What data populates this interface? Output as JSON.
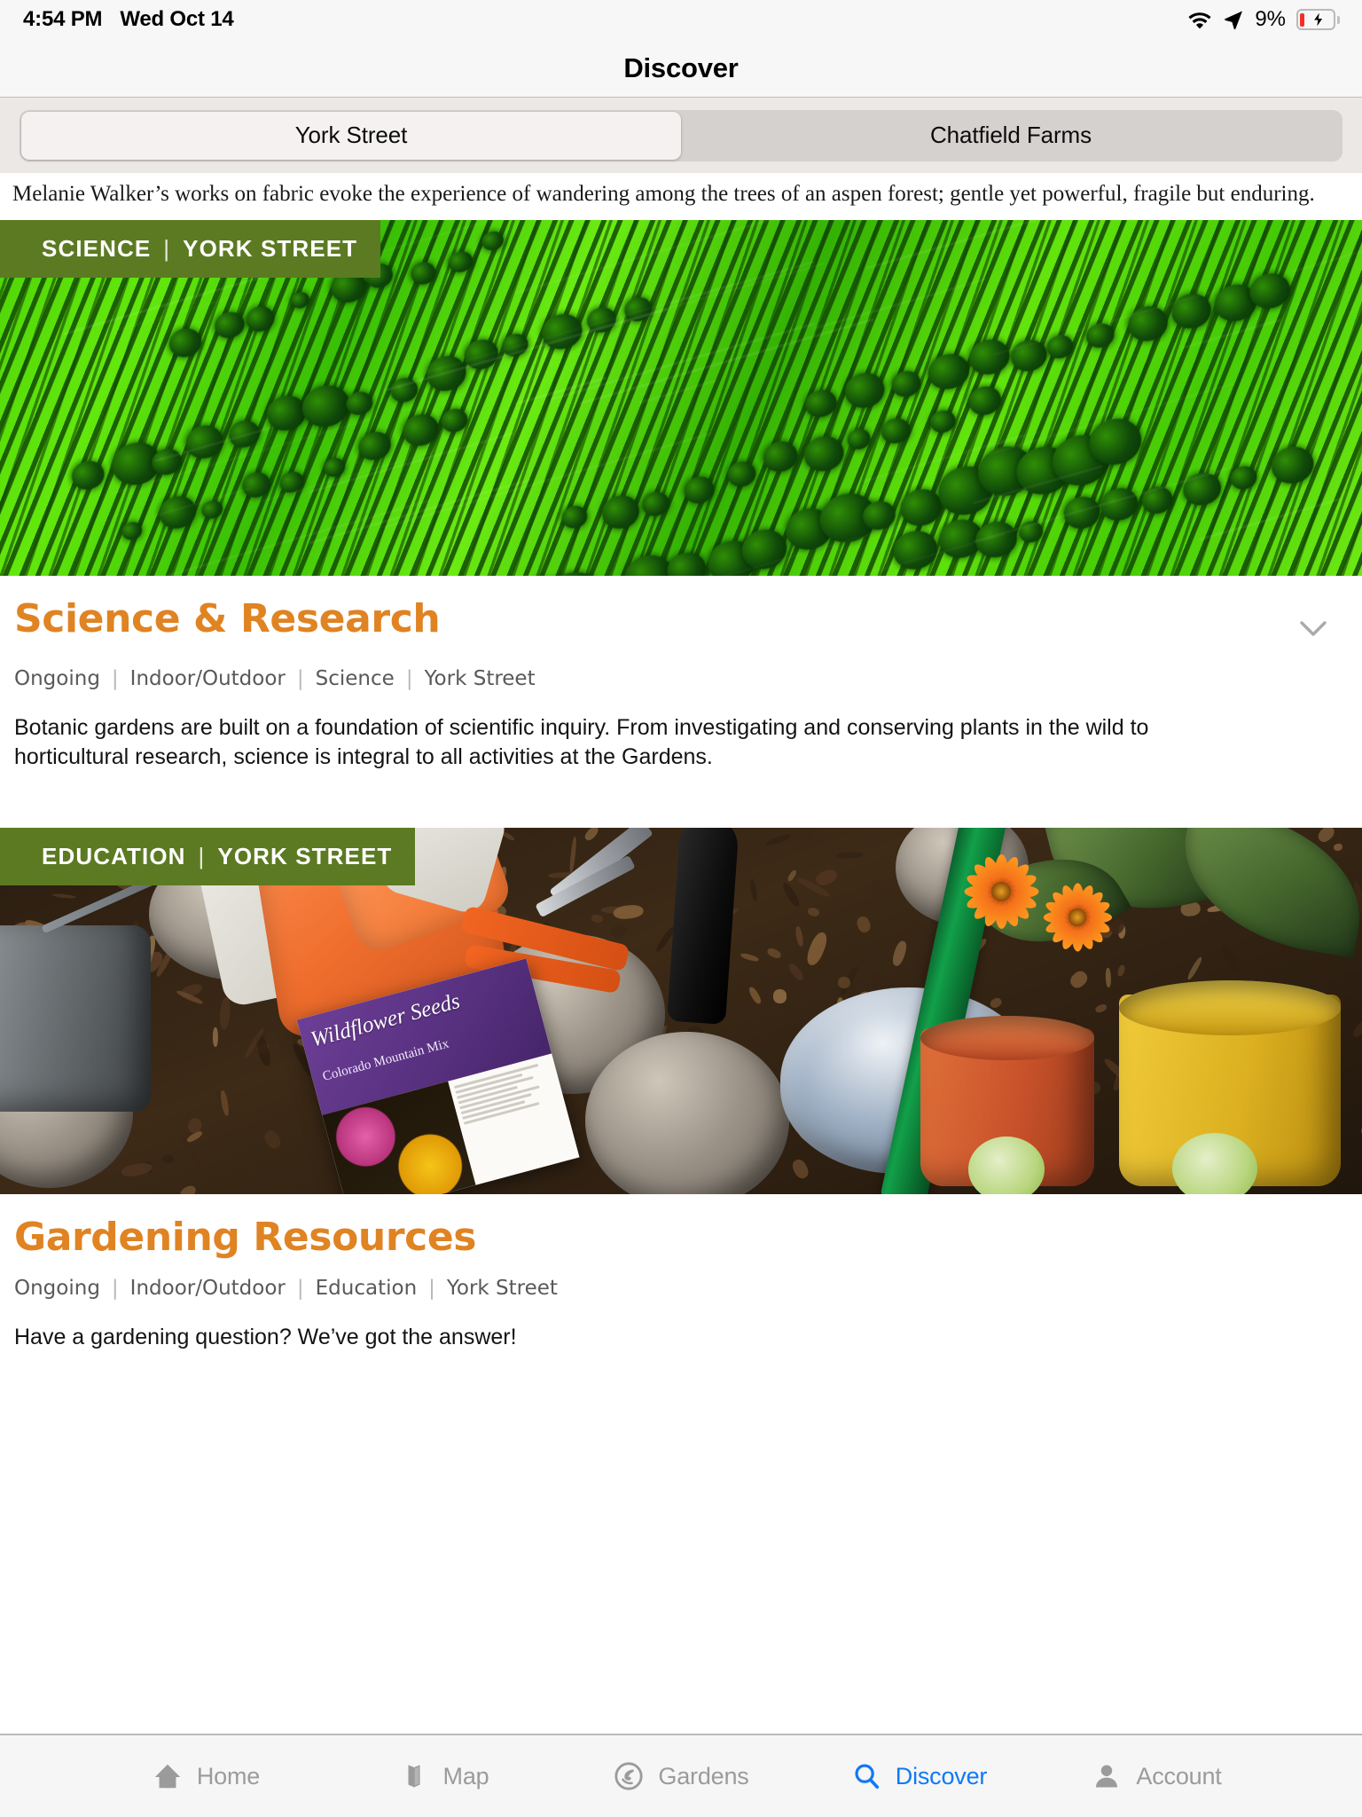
{
  "status_bar": {
    "time": "4:54 PM",
    "date": "Wed Oct 14",
    "wifi_icon": "wifi-icon",
    "location_icon": "location-arrow-icon",
    "battery_percent": "9%",
    "battery_icon": "battery-charging-icon",
    "battery_level": 9,
    "battery_color": "#f03027"
  },
  "navbar": {
    "title": "Discover"
  },
  "segmented_control": {
    "selected_index": 0,
    "options": [
      {
        "label": "York Street",
        "selected": true
      },
      {
        "label": "Chatfield Farms",
        "selected": false
      }
    ]
  },
  "lead_text": "Melanie Walker’s works on fabric evoke the experience of wandering among the trees of an aspen forest; gentle yet powerful, fragile but enduring.",
  "colors": {
    "accent_orange": "#e08322",
    "banner_green": "#5c7a22",
    "active_tab_blue": "#1079f5",
    "meta_gray": "#58595b"
  },
  "cards": [
    {
      "banner_category": "SCIENCE",
      "banner_divider": "|",
      "banner_location": "YORK STREET",
      "image_alt": "green plant cell microscopy",
      "title": "Science & Research",
      "meta": [
        "Ongoing",
        "Indoor/Outdoor",
        "Science",
        "York Street"
      ],
      "description": "Botanic gardens are built on a foundation of scientific inquiry. From investigating and conserving plants in the wild to horticultural research, science is integral to all activities at the Gardens.",
      "chevron_icon": "chevron-down-icon",
      "has_chevron": true
    },
    {
      "banner_category": "EDUCATION",
      "banner_divider": "|",
      "banner_location": "YORK STREET",
      "image_alt": "gardening tools, gloves, pots and wildflower seed packet",
      "title": "Gardening Resources",
      "meta": [
        "Ongoing",
        "Indoor/Outdoor",
        "Education",
        "York Street"
      ],
      "description": "Have a gardening question? We’ve got the answer!",
      "chevron_icon": "chevron-down-icon",
      "has_chevron": false
    }
  ],
  "seed_packet": {
    "title": "Wildflower Seeds",
    "subtitle": "Colorado Mountain Mix"
  },
  "tab_bar": {
    "active": "Discover",
    "tabs": [
      {
        "label": "Home",
        "icon": "home-icon",
        "active": false
      },
      {
        "label": "Map",
        "icon": "map-icon",
        "active": false
      },
      {
        "label": "Gardens",
        "icon": "gardens-leaf-icon",
        "active": false
      },
      {
        "label": "Discover",
        "icon": "search-icon",
        "active": true
      },
      {
        "label": "Account",
        "icon": "person-icon",
        "active": false
      }
    ]
  }
}
